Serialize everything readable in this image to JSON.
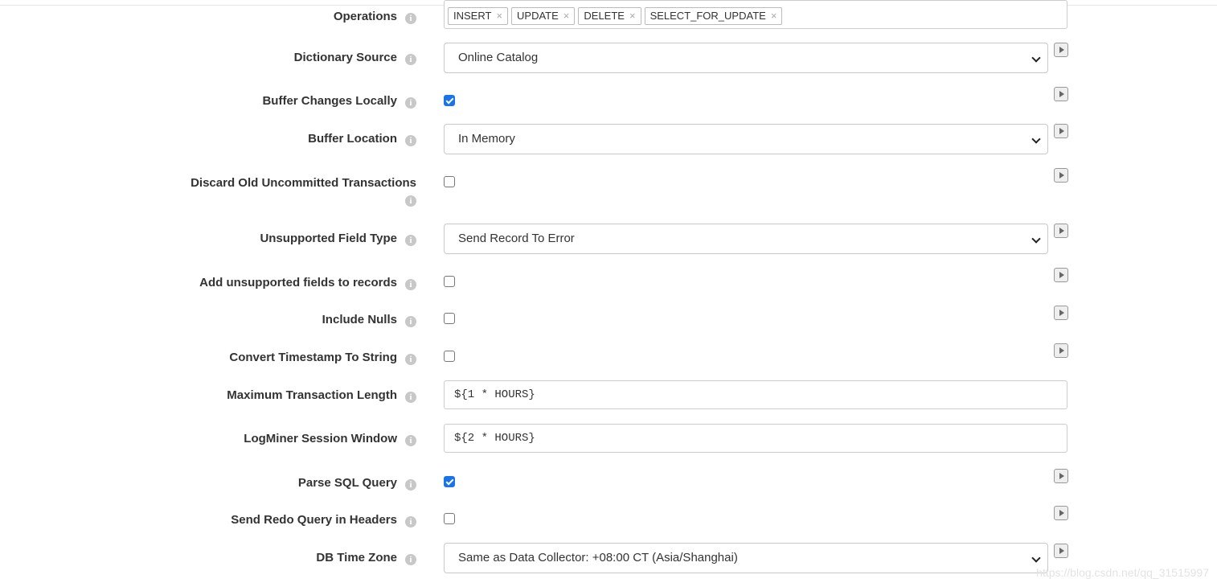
{
  "fields": {
    "operations": {
      "label": "Operations",
      "tags": [
        "INSERT",
        "UPDATE",
        "DELETE",
        "SELECT_FOR_UPDATE"
      ],
      "remove_glyph": "×"
    },
    "dictionary_source": {
      "label": "Dictionary Source",
      "value": "Online Catalog"
    },
    "buffer_changes_locally": {
      "label": "Buffer Changes Locally",
      "checked": true
    },
    "buffer_location": {
      "label": "Buffer Location",
      "value": "In Memory"
    },
    "discard_old_uncommitted": {
      "label": "Discard Old Uncommitted Transactions",
      "checked": false
    },
    "unsupported_field_type": {
      "label": "Unsupported Field Type",
      "value": "Send Record To Error"
    },
    "add_unsupported_fields": {
      "label": "Add unsupported fields to records",
      "checked": false
    },
    "include_nulls": {
      "label": "Include Nulls",
      "checked": false
    },
    "convert_timestamp": {
      "label": "Convert Timestamp To String",
      "checked": false
    },
    "max_transaction_length": {
      "label": "Maximum Transaction Length",
      "value": "${1 * HOURS}"
    },
    "logminer_session_window": {
      "label": "LogMiner Session Window",
      "value": "${2 * HOURS}"
    },
    "parse_sql_query": {
      "label": "Parse SQL Query",
      "checked": true
    },
    "send_redo_query": {
      "label": "Send Redo Query in Headers",
      "checked": false
    },
    "db_time_zone": {
      "label": "DB Time Zone",
      "value": "Same as Data Collector: +08:00 CT (Asia/Shanghai)"
    }
  },
  "icons": {
    "info": "info-icon",
    "play": "play-icon",
    "select_arrow": "chevron-down-icon"
  },
  "info_glyph": "i",
  "colors": {
    "checkbox_checked": "#1a73e8",
    "label_text": "#333333",
    "info_icon": "#c8c8c8"
  },
  "watermark": "https://blog.csdn.net/qq_31515997"
}
